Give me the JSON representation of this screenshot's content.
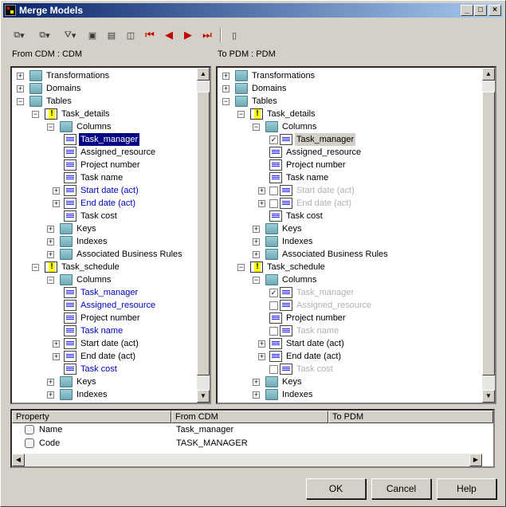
{
  "window": {
    "title": "Merge Models",
    "controls": {
      "min": "_",
      "max": "□",
      "close": "×"
    }
  },
  "toolbar": {
    "select_icon": "⧉",
    "collapse_icon": "⧉",
    "filter_icon": "⛛",
    "a1": "▣",
    "a2": "▤",
    "a3": "◫",
    "first": "⏮",
    "prev": "◀",
    "next": "▶",
    "last": "⏭",
    "page": "▯",
    "dd": "▾"
  },
  "left": {
    "header": "From CDM : CDM",
    "rows": [
      {
        "label": "Transformations",
        "level": 0,
        "icon": "folder",
        "exp": "+"
      },
      {
        "label": "Domains",
        "level": 0,
        "icon": "folder",
        "exp": "+"
      },
      {
        "label": "Tables",
        "level": 0,
        "icon": "folder-warn",
        "exp": "−"
      },
      {
        "label": "Task_details",
        "level": 1,
        "icon": "table",
        "exp": "−"
      },
      {
        "label": "Columns",
        "level": 2,
        "icon": "folder-warn",
        "exp": "−"
      },
      {
        "label": "Task_manager",
        "level": 3,
        "icon": "column",
        "state": "sel"
      },
      {
        "label": "Assigned_resource",
        "level": 3,
        "icon": "column"
      },
      {
        "label": "Project number",
        "level": 3,
        "icon": "column"
      },
      {
        "label": "Task name",
        "level": 3,
        "icon": "column"
      },
      {
        "label": "Start date (act)",
        "level": 3,
        "icon": "column",
        "state": "blue",
        "exp": "+"
      },
      {
        "label": "End date (act)",
        "level": 3,
        "icon": "column",
        "state": "blue",
        "exp": "+"
      },
      {
        "label": "Task cost",
        "level": 3,
        "icon": "column"
      },
      {
        "label": "Keys",
        "level": 2,
        "icon": "folder",
        "exp": "+"
      },
      {
        "label": "Indexes",
        "level": 2,
        "icon": "folder",
        "exp": "+"
      },
      {
        "label": "Associated Business Rules",
        "level": 2,
        "icon": "folder",
        "exp": "+"
      },
      {
        "label": "Task_schedule",
        "level": 1,
        "icon": "table",
        "exp": "−"
      },
      {
        "label": "Columns",
        "level": 2,
        "icon": "folder-warn",
        "exp": "−"
      },
      {
        "label": "Task_manager",
        "level": 3,
        "icon": "column",
        "state": "blue"
      },
      {
        "label": "Assigned_resource",
        "level": 3,
        "icon": "column",
        "state": "blue"
      },
      {
        "label": "Project number",
        "level": 3,
        "icon": "column"
      },
      {
        "label": "Task name",
        "level": 3,
        "icon": "column",
        "state": "blue"
      },
      {
        "label": "Start date (act)",
        "level": 3,
        "icon": "column",
        "exp": "+"
      },
      {
        "label": "End date (act)",
        "level": 3,
        "icon": "column",
        "exp": "+"
      },
      {
        "label": "Task cost",
        "level": 3,
        "icon": "column",
        "state": "blue"
      },
      {
        "label": "Keys",
        "level": 2,
        "icon": "folder",
        "exp": "+"
      },
      {
        "label": "Indexes",
        "level": 2,
        "icon": "folder",
        "exp": "+"
      }
    ]
  },
  "right": {
    "header": "To PDM : PDM",
    "rows": [
      {
        "label": "Transformations",
        "level": 0,
        "icon": "folder",
        "exp": "+"
      },
      {
        "label": "Domains",
        "level": 0,
        "icon": "folder",
        "exp": "+"
      },
      {
        "label": "Tables",
        "level": 0,
        "icon": "folder-warn",
        "exp": "−"
      },
      {
        "label": "Task_details",
        "level": 1,
        "icon": "table",
        "exp": "−"
      },
      {
        "label": "Columns",
        "level": 2,
        "icon": "folder-warn",
        "exp": "−"
      },
      {
        "label": "Task_manager",
        "level": 3,
        "icon": "column-add",
        "state": "selg",
        "check": true
      },
      {
        "label": "Assigned_resource",
        "level": 3,
        "icon": "column"
      },
      {
        "label": "Project number",
        "level": 3,
        "icon": "column"
      },
      {
        "label": "Task name",
        "level": 3,
        "icon": "column"
      },
      {
        "label": "Start date (act)",
        "level": 3,
        "icon": "column-add",
        "state": "gray",
        "check": false,
        "exp": "+"
      },
      {
        "label": "End date (act)",
        "level": 3,
        "icon": "column-add",
        "state": "gray",
        "check": false,
        "exp": "+"
      },
      {
        "label": "Task cost",
        "level": 3,
        "icon": "column"
      },
      {
        "label": "Keys",
        "level": 2,
        "icon": "folder",
        "exp": "+"
      },
      {
        "label": "Indexes",
        "level": 2,
        "icon": "folder",
        "exp": "+"
      },
      {
        "label": "Associated Business Rules",
        "level": 2,
        "icon": "folder",
        "exp": "+"
      },
      {
        "label": "Task_schedule",
        "level": 1,
        "icon": "table",
        "exp": "−"
      },
      {
        "label": "Columns",
        "level": 2,
        "icon": "folder-warn",
        "exp": "−"
      },
      {
        "label": "Task_manager",
        "level": 3,
        "icon": "column-add",
        "state": "gray",
        "check": true
      },
      {
        "label": "Assigned_resource",
        "level": 3,
        "icon": "column-add",
        "state": "gray",
        "check": false
      },
      {
        "label": "Project number",
        "level": 3,
        "icon": "column"
      },
      {
        "label": "Task name",
        "level": 3,
        "icon": "column-add",
        "state": "gray",
        "check": false
      },
      {
        "label": "Start date (act)",
        "level": 3,
        "icon": "column",
        "exp": "+"
      },
      {
        "label": "End date (act)",
        "level": 3,
        "icon": "column",
        "exp": "+"
      },
      {
        "label": "Task cost",
        "level": 3,
        "icon": "column-add",
        "state": "gray",
        "check": false
      },
      {
        "label": "Keys",
        "level": 2,
        "icon": "folder",
        "exp": "+"
      },
      {
        "label": "Indexes",
        "level": 2,
        "icon": "folder",
        "exp": "+"
      }
    ]
  },
  "properties": {
    "columns": [
      "Property",
      "From CDM",
      "To PDM"
    ],
    "rows": [
      {
        "property": "Name",
        "from": "Task_manager",
        "to": ""
      },
      {
        "property": "Code",
        "from": "TASK_MANAGER",
        "to": ""
      }
    ]
  },
  "buttons": {
    "ok": "OK",
    "cancel": "Cancel",
    "help": "Help"
  }
}
